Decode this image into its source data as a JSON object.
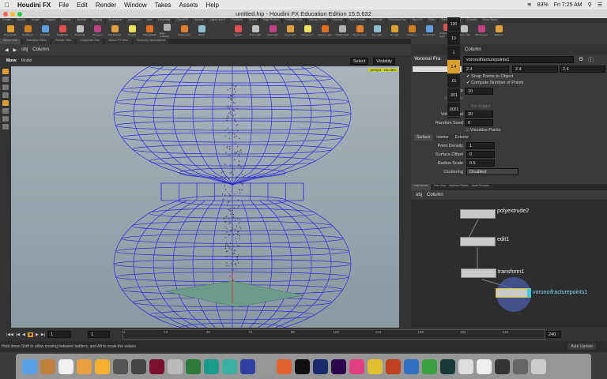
{
  "menubar": {
    "app": "Houdini FX",
    "items": [
      "File",
      "Edit",
      "Render",
      "Window",
      "Takes",
      "Assets",
      "Help"
    ],
    "battery": "83%",
    "clock": "Fri 7:25 AM"
  },
  "window": {
    "title": "untitled.hip - Houdini FX Education Edition 15.5.632"
  },
  "shelf": {
    "tabs_left": [
      "Create",
      "Modify",
      "Model",
      "Polygon",
      "Deform",
      "Texture",
      "Rigging",
      "Characters",
      "Animation",
      "Hair",
      "Grooming",
      "Cloud FX",
      "Volume"
    ],
    "tabs_right": [
      "Lights and C",
      "Particles",
      "Grains",
      "Rigid Bodies",
      "Particle Fluids",
      "Viscous Fluids",
      "Oceans",
      "Fluid Contain",
      "Populate",
      "Container Too",
      "Pyro FX",
      "Cloth",
      "Solid",
      "Wires",
      "Crowds",
      "Drive Simul"
    ],
    "tools_left": [
      "Polyextrude",
      "PolyBevel",
      "PolySplit",
      "PolyBridge",
      "PolyKnife",
      "Boolean",
      "PolyReduce",
      "PolyFill",
      "TriangulateB",
      "Edge Collapse",
      "Edge Cusp",
      "Soften"
    ],
    "tools_right": [
      "Camera",
      "Point Light",
      "Spot Light",
      "Area Light",
      "Geometry L",
      "Volume Light",
      "Distant Light",
      "Environment",
      "Sky Light",
      "GI Light",
      "Caustic Lt",
      "Portal Light",
      "Ambient Light",
      "Stereo Cam",
      "VR Camera",
      "Switcher"
    ]
  },
  "panes": {
    "left_tabs": [
      "Scene View",
      "Animation Editor",
      "Render View",
      "Composite View",
      "Motion FX View",
      "Geometry Spreadsheet"
    ],
    "path_obj": "obj",
    "path_node": "Column",
    "move_label": "Move",
    "mode_label": "Model",
    "select_label": "Select",
    "visibility_label": "Visibility",
    "camera_label": "persp1",
    "cam_badge": "no cam"
  },
  "ladder": [
    "100",
    "10",
    "1",
    "2.4",
    "0.1",
    ".01",
    ".001",
    ".0001"
  ],
  "params": {
    "node_type": "Voronoi Fra",
    "node_name": "voronoifracturepoints1",
    "scale_values": [
      "2.4",
      "2.4",
      "2.4"
    ],
    "snap_label": "Snap Points to Object",
    "compute_label": "Compute Number of Points",
    "points_label": "Points P",
    "points_value": "10",
    "relative_label": "Relative to",
    "per_impact": "Per Impact",
    "volume_label": "Volume Rel",
    "volume_value": "30",
    "seed_label": "Random Seed",
    "seed_value": "0",
    "visualize_label": "Visualize Points",
    "subtabs": [
      "Surface",
      "Interior",
      "Exterior"
    ],
    "density_label": "Point Density",
    "density_value": "1",
    "offset_label": "Surface Offset",
    "offset_value": "0",
    "radius_label": "Radius Scale",
    "radius_value": "0.5",
    "cluster_label": "Clustering",
    "cluster_value": "Disabled"
  },
  "network": {
    "tabs": [
      "/obj/Column",
      "Tree View",
      "Material Palette",
      "Asset Browser"
    ],
    "path_obj": "obj",
    "path_node": "Column",
    "nodes": [
      "polyextrude2",
      "edit1",
      "transform1",
      "voronoifracturepoints1"
    ]
  },
  "timeline": {
    "frame": "1",
    "start": "1",
    "end": "240",
    "ticks": [
      "1",
      "24",
      "48",
      "72",
      "96",
      "120",
      "144",
      "168",
      "192",
      "216"
    ],
    "auto_update": "Auto Update"
  },
  "status": "Hold down Shift to allow moving between ladders, and Alt to scale the values",
  "colors": {
    "wire": "#2a2ad8",
    "accent": "#e0a020",
    "selected_node": "#3fc7e0"
  }
}
